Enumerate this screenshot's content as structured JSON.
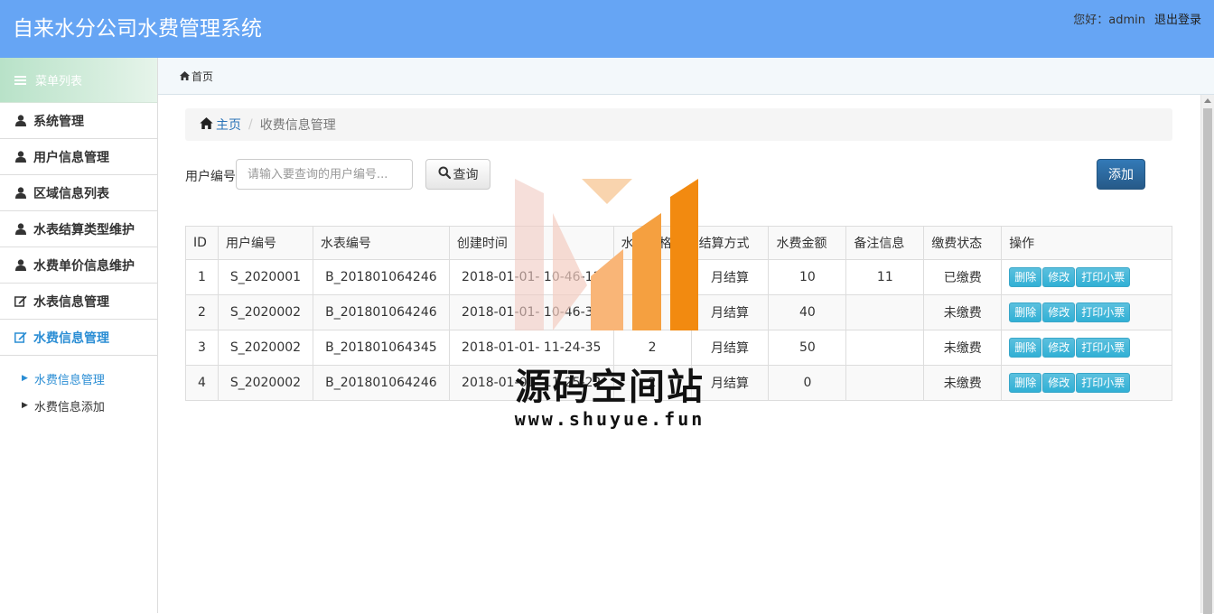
{
  "header": {
    "title": "自来水分公司水费管理系统",
    "greeting": "您好：",
    "username": "admin",
    "logout": "退出登录"
  },
  "sidebar": {
    "menu_title": "菜单列表",
    "items": [
      {
        "label": "系统管理",
        "icon": "user-icon"
      },
      {
        "label": "用户信息管理",
        "icon": "user-icon"
      },
      {
        "label": "区域信息列表",
        "icon": "user-icon"
      },
      {
        "label": "水表结算类型维护",
        "icon": "user-icon"
      },
      {
        "label": "水费单价信息维护",
        "icon": "user-icon"
      },
      {
        "label": "水表信息管理",
        "icon": "edit-icon"
      },
      {
        "label": "水费信息管理",
        "icon": "edit-icon",
        "active": true
      }
    ],
    "sub_items": [
      {
        "label": "水费信息管理",
        "active": true
      },
      {
        "label": "水费信息添加"
      }
    ]
  },
  "tabbar": {
    "home_tab": "首页"
  },
  "breadcrumb": {
    "home": "主页",
    "current": "收费信息管理"
  },
  "search": {
    "label": "用户编号",
    "placeholder": "请输入要查询的用户编号...",
    "button": "查询",
    "add_button": "添加"
  },
  "table": {
    "columns": [
      "ID",
      "用户编号",
      "水表编号",
      "创建时间",
      "水费价格",
      "结算方式",
      "水费金额",
      "备注信息",
      "缴费状态",
      "操作"
    ],
    "rows": [
      {
        "id": "1",
        "user": "S_2020001",
        "meter": "B_201801064246",
        "created": "2018-01-01- 10-46-11",
        "price": "2",
        "method": "月结算",
        "amount": "10",
        "note": "11",
        "status": "已缴费"
      },
      {
        "id": "2",
        "user": "S_2020002",
        "meter": "B_201801064246",
        "created": "2018-01-01- 10-46-39",
        "price": "2",
        "method": "月结算",
        "amount": "40",
        "note": "",
        "status": "未缴费"
      },
      {
        "id": "3",
        "user": "S_2020002",
        "meter": "B_201801064345",
        "created": "2018-01-01- 11-24-35",
        "price": "2",
        "method": "月结算",
        "amount": "50",
        "note": "",
        "status": "未缴费"
      },
      {
        "id": "4",
        "user": "S_2020002",
        "meter": "B_201801064246",
        "created": "2018-01-01- 11-25-22",
        "price": "2",
        "method": "月结算",
        "amount": "0",
        "note": "",
        "status": "未缴费"
      }
    ],
    "actions": {
      "delete": "删除",
      "edit": "修改",
      "print": "打印小票"
    }
  },
  "watermark": {
    "name": "源码空间站",
    "url": "www.shuyue.fun"
  },
  "colors": {
    "header": "#66a5f4",
    "primary": "#337ab7",
    "info": "#5bc0de",
    "active_link": "#2a8dd4"
  }
}
